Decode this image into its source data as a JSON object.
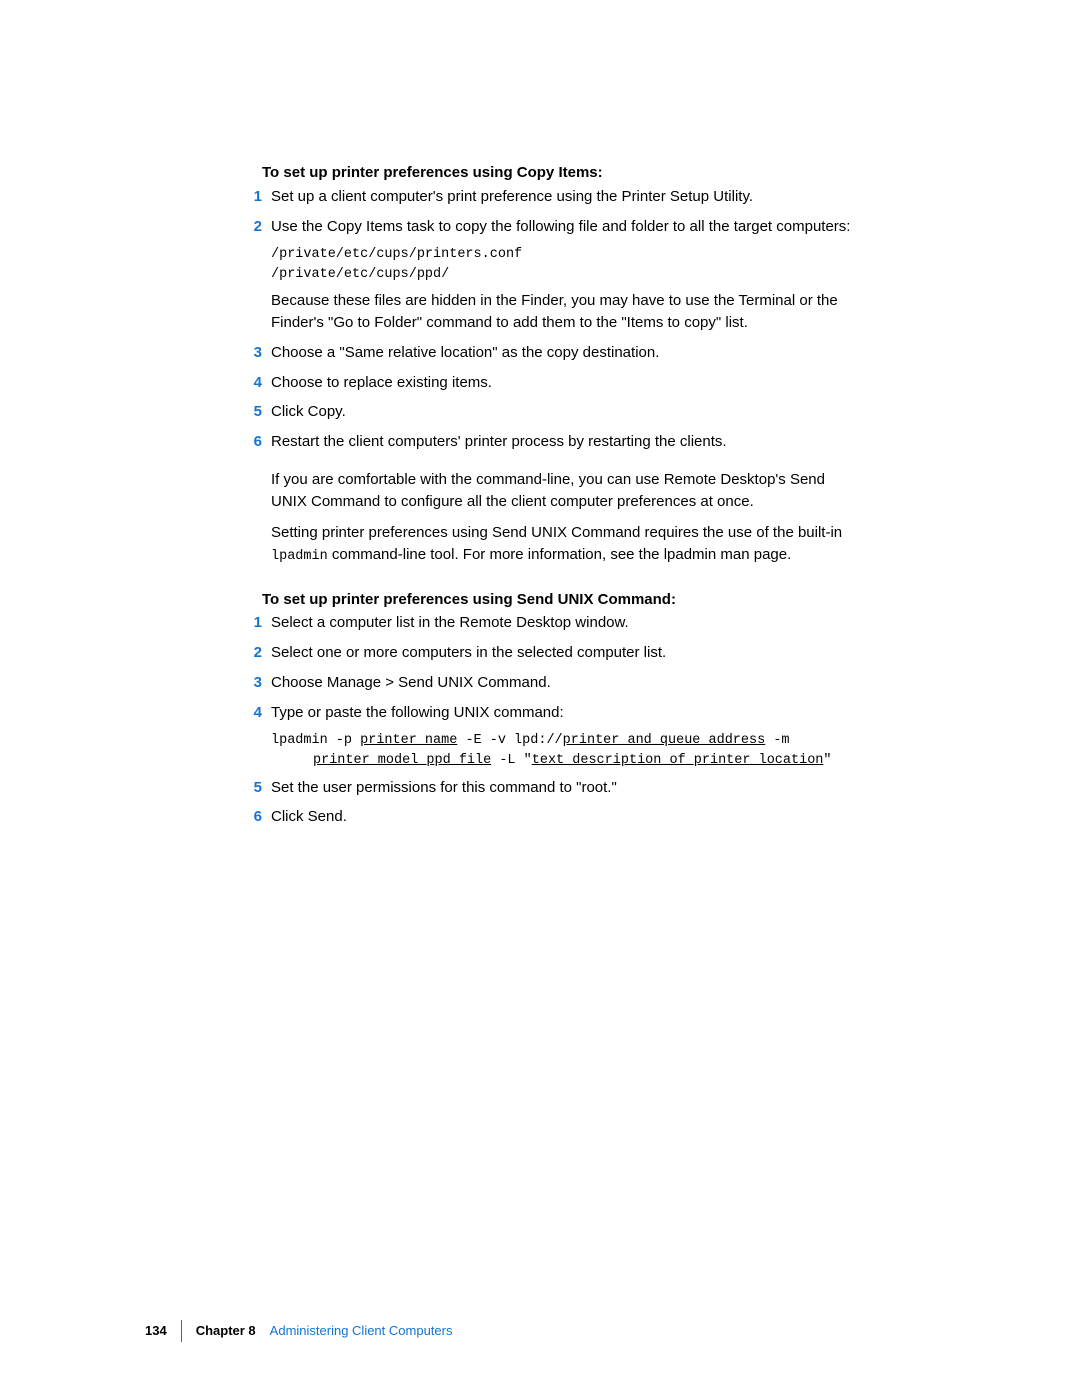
{
  "section1": {
    "heading": "To set up printer preferences using Copy Items:",
    "steps": [
      {
        "n": "1",
        "text": "Set up a client computer's print preference using the Printer Setup Utility."
      },
      {
        "n": "2",
        "text": "Use the Copy Items task to copy the following file and folder to all the target computers:"
      }
    ],
    "code1_line1": "/private/etc/cups/printers.conf",
    "code1_line2": "/private/etc/cups/ppd/",
    "after_code_para": "Because these files are hidden in the Finder, you may have to use the Terminal or the Finder's \"Go to Folder\" command to add them to the \"Items to copy\" list.",
    "steps2": [
      {
        "n": "3",
        "text": "Choose a \"Same relative location\" as the copy destination."
      },
      {
        "n": "4",
        "text": "Choose to replace existing items."
      },
      {
        "n": "5",
        "text": "Click Copy."
      },
      {
        "n": "6",
        "text": "Restart the client computers' printer process by restarting the clients."
      }
    ],
    "para1": "If you are comfortable with the command-line, you can use Remote Desktop's Send UNIX Command to configure all the client computer preferences at once.",
    "para2_pre": "Setting printer preferences using Send UNIX Command requires the use of the built-in ",
    "para2_code": "lpadmin",
    "para2_post": " command-line tool. For more information, see the lpadmin man page."
  },
  "section2": {
    "heading": "To set up printer preferences using Send UNIX Command:",
    "steps": [
      {
        "n": "1",
        "text": "Select a computer list in the Remote Desktop window."
      },
      {
        "n": "2",
        "text": "Select one or more computers in the selected computer list."
      },
      {
        "n": "3",
        "text": "Choose Manage > Send UNIX Command."
      },
      {
        "n": "4",
        "text": "Type or paste the following UNIX command:"
      }
    ],
    "cmd": {
      "a": "lpadmin -p ",
      "b": "printer_name",
      "c": " -E -v lpd://",
      "d": "printer_and_queue_address",
      "e": " -m ",
      "f": "printer_model_ppd_file",
      "g": " -L \"",
      "h": "text_description_of_printer_location",
      "i": "\""
    },
    "steps2": [
      {
        "n": "5",
        "text": "Set the user permissions for this command to \"root.\""
      },
      {
        "n": "6",
        "text": "Click Send."
      }
    ]
  },
  "footer": {
    "page": "134",
    "chapter_label": "Chapter 8",
    "chapter_title": "Administering Client Computers"
  }
}
